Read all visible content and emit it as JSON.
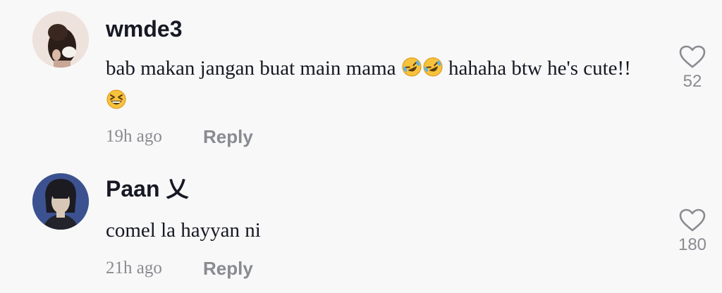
{
  "comments": [
    {
      "username": "wmde3",
      "text_before": "bab makan jangan buat main mama ",
      "text_after": " hahaha btw he's cute!! ",
      "emojis": [
        "rolling-on-floor-laughing-icon",
        "rolling-on-floor-laughing-icon",
        "grinning-squinting-face-icon"
      ],
      "time": "19h ago",
      "reply_label": "Reply",
      "likes": "52"
    },
    {
      "username": "Paan 乂",
      "text": "comel la hayyan ni",
      "time": "21h ago",
      "reply_label": "Reply",
      "likes": "180"
    }
  ],
  "colors": {
    "background": "#f8f8f8",
    "primary_text": "#161823",
    "secondary_text": "#8a8b91",
    "emoji_yellow": "#f7c23c"
  }
}
